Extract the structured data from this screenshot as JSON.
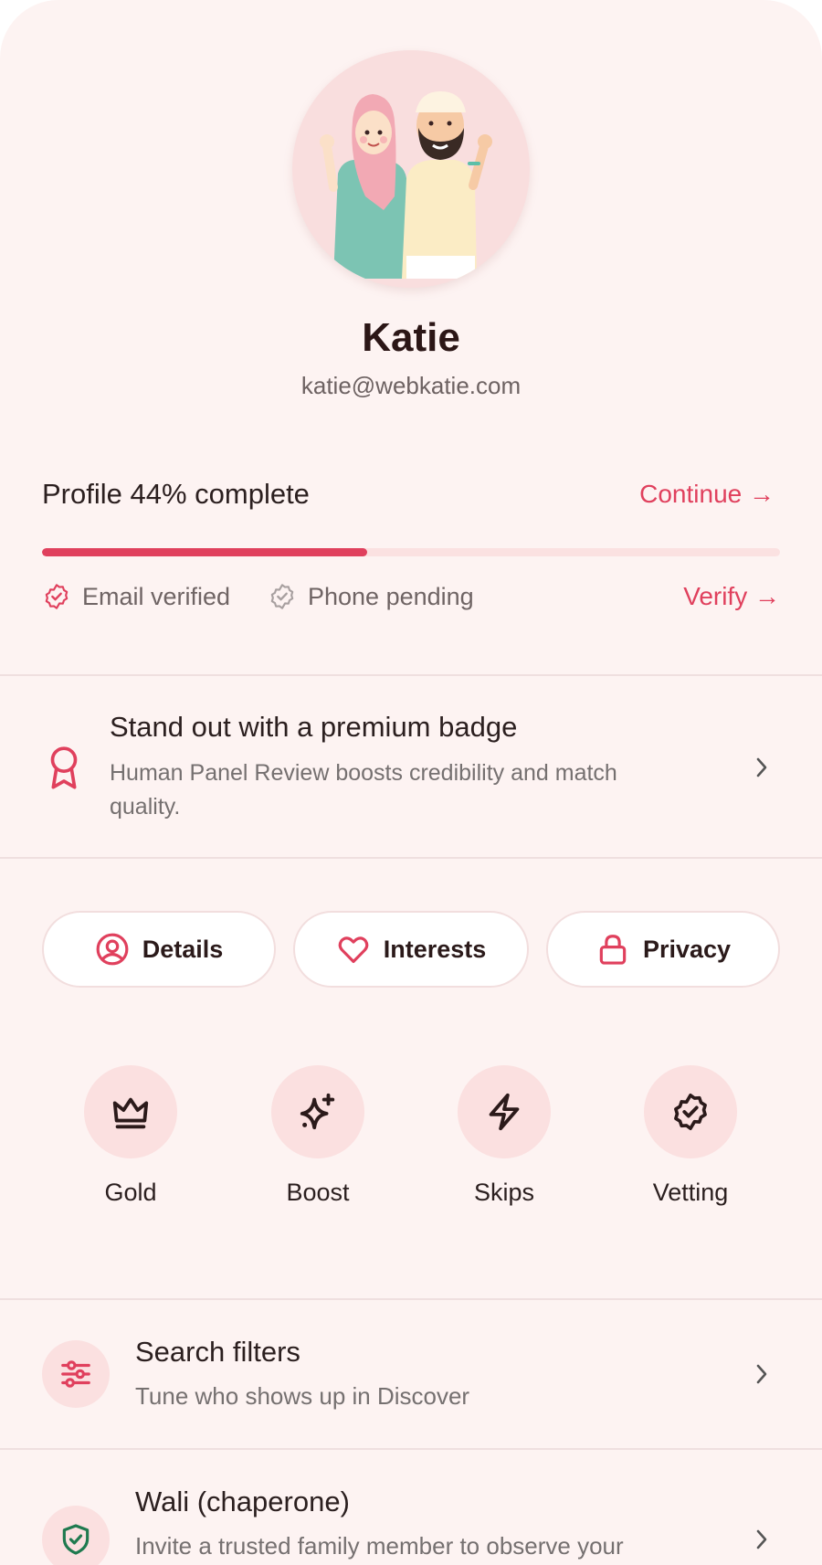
{
  "user": {
    "name": "Katie",
    "email": "katie@webkatie.com"
  },
  "profile": {
    "title": "Profile 44% complete",
    "progress_percent": 44,
    "continue_label": "Continue →"
  },
  "verification": {
    "email_status": "Email verified",
    "phone_status": "Phone pending",
    "verify_label": "Verify →"
  },
  "premium": {
    "title": "Stand out with a premium badge",
    "subtitle": "Human Panel Review boosts credibility and match quality."
  },
  "tabs": [
    {
      "label": "Details",
      "icon": "user-circle-icon"
    },
    {
      "label": "Interests",
      "icon": "heart-icon"
    },
    {
      "label": "Privacy",
      "icon": "lock-icon"
    }
  ],
  "features": [
    {
      "label": "Gold",
      "icon": "crown-icon"
    },
    {
      "label": "Boost",
      "icon": "sparkles-icon"
    },
    {
      "label": "Skips",
      "icon": "lightning-icon"
    },
    {
      "label": "Vetting",
      "icon": "badge-check-icon"
    }
  ],
  "settings": [
    {
      "title": "Search filters",
      "subtitle": "Tune who shows up in Discover",
      "icon": "sliders-icon"
    },
    {
      "title": "Wali (chaperone)",
      "subtitle": "Invite a trusted family member to observe your",
      "icon": "shield-check-icon"
    }
  ],
  "colors": {
    "accent": "#e0405d",
    "background": "#fdf3f2",
    "icon_bg": "#fbe0e0",
    "shield_green": "#1f7a4f"
  }
}
